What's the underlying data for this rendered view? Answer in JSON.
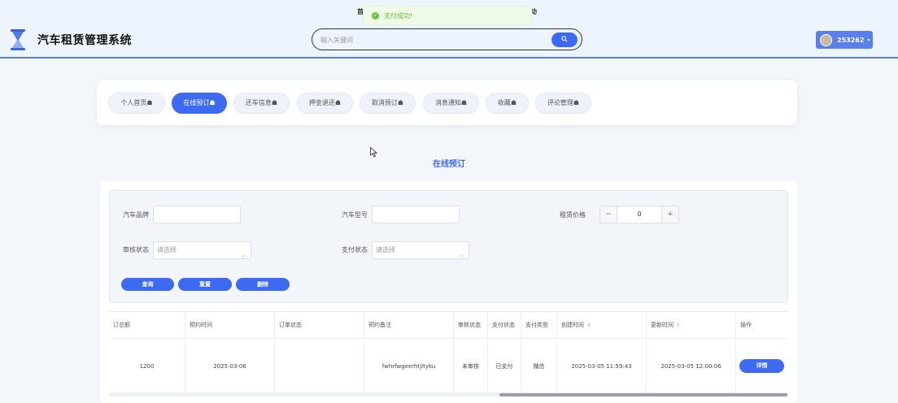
{
  "header": {
    "app_title": "汽车租赁管理系统",
    "nav_fragment_left": "首",
    "nav_fragment_right": "动",
    "toast_text": "支付成功!",
    "search_placeholder": "输入关键词",
    "user_name": "253262"
  },
  "tabs": [
    {
      "label": "个人首页"
    },
    {
      "label": "在线预订",
      "active": true
    },
    {
      "label": "还车信息"
    },
    {
      "label": "押金退还"
    },
    {
      "label": "取消预订"
    },
    {
      "label": "消息通知"
    },
    {
      "label": "收藏"
    },
    {
      "label": "评论管理"
    }
  ],
  "page_heading": "在线预订",
  "filters": {
    "car_brand_label": "汽车品牌",
    "car_brand_value": "",
    "car_model_label": "汽车型号",
    "car_model_value": "",
    "price_label": "租赁价格",
    "price_value": "0",
    "review_status_label": "审核状态",
    "review_status_placeholder": "请选择",
    "pay_status_label": "支付状态",
    "pay_status_placeholder": "请选择"
  },
  "buttons": {
    "query": "查询",
    "reset": "重置",
    "delete": "删除"
  },
  "table": {
    "columns": [
      "订总额",
      "预约时间",
      "订单状态",
      "预约备注",
      "审核状态",
      "支付状态",
      "支付类型",
      "创建时间",
      "更新时间",
      "操作"
    ],
    "rows": [
      {
        "amount": "1200",
        "booking_date": "2025-03-06",
        "order_status": "",
        "remark": "fwhrfwgeerhtjltyku",
        "review_status": "未审核",
        "pay_status": "已支付",
        "pay_type": "微信",
        "created": "2025-03-05 11:59:43",
        "updated": "2025-03-05 12:00:06",
        "action": "详情"
      }
    ]
  },
  "colors": {
    "accent": "#3d6af0",
    "success": "#67c23a"
  }
}
